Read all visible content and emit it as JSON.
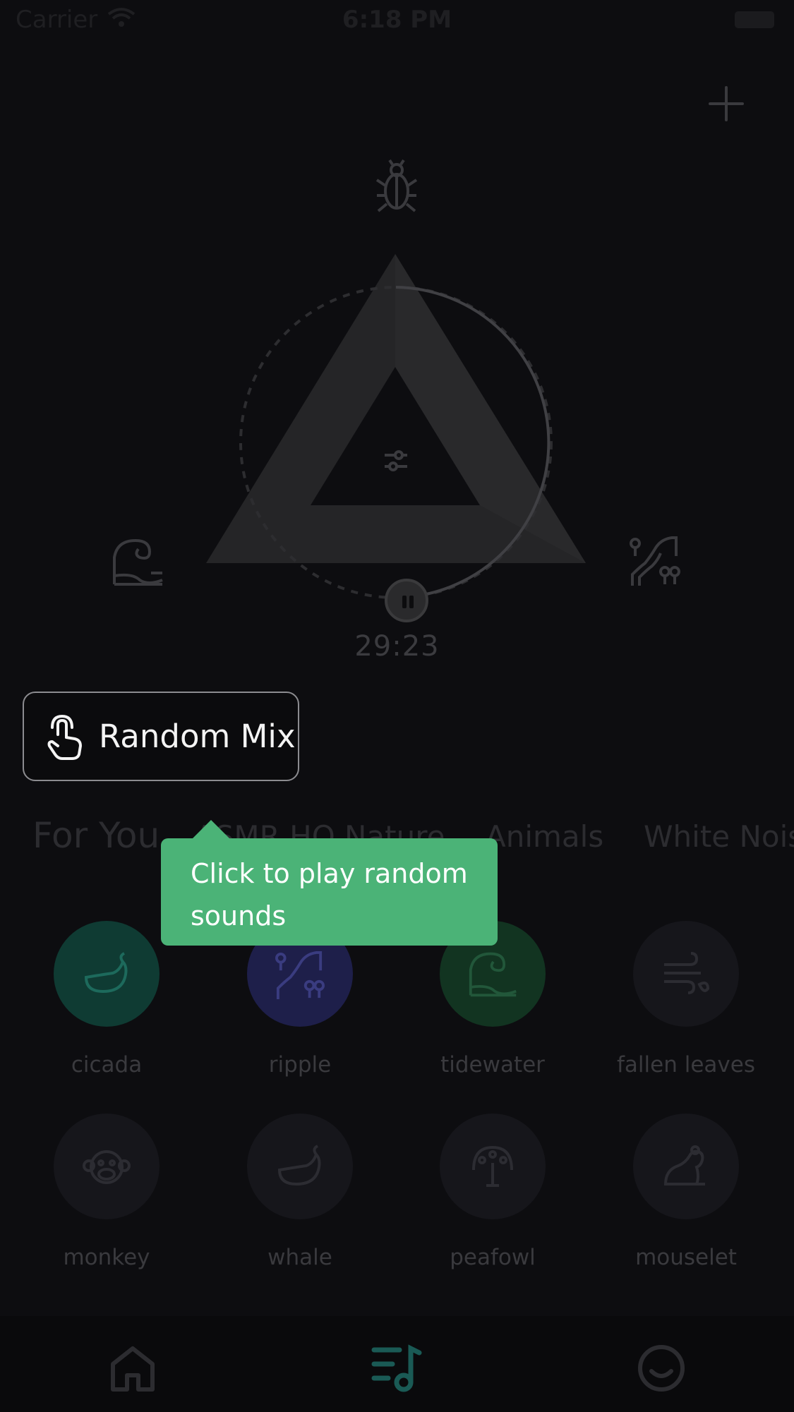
{
  "status_bar": {
    "carrier": "Carrier",
    "time": "6:18 PM"
  },
  "header": {
    "add_icon": "plus-icon"
  },
  "mixer": {
    "top_sound_icon": "beetle-icon",
    "left_sound_icon": "wave-icon",
    "right_sound_icon": "waterfall-icon",
    "center_icon": "sliders-icon",
    "timer": "29:23",
    "progress": 0.75
  },
  "random_mix": {
    "label": "Random Mix",
    "icon": "tap-hand-icon"
  },
  "category_tabs": [
    "For You",
    "ASMR HQ",
    "Nature",
    "Animals",
    "White Noise"
  ],
  "tooltip": {
    "text": "Click to play random sounds"
  },
  "sounds": [
    {
      "label": "cicada",
      "icon": "whale-icon",
      "color": "#0f3b33"
    },
    {
      "label": "ripple",
      "icon": "waterfall-icon",
      "color": "#1e1f4a"
    },
    {
      "label": "tidewater",
      "icon": "wave-icon",
      "color": "#123421"
    },
    {
      "label": "fallen leaves",
      "icon": "wind-leaf-icon",
      "color": "#16161b"
    },
    {
      "label": "monkey",
      "icon": "monkey-icon",
      "color": "#16161b"
    },
    {
      "label": "whale",
      "icon": "whale-icon",
      "color": "#16161b"
    },
    {
      "label": "peafowl",
      "icon": "peacock-icon",
      "color": "#16161b"
    },
    {
      "label": "mouselet",
      "icon": "mouse-icon",
      "color": "#16161b"
    }
  ],
  "tab_bar": {
    "home_icon": "home-icon",
    "sounds_icon": "music-list-icon",
    "profile_icon": "smile-icon",
    "active_color": "#1a5a55"
  }
}
